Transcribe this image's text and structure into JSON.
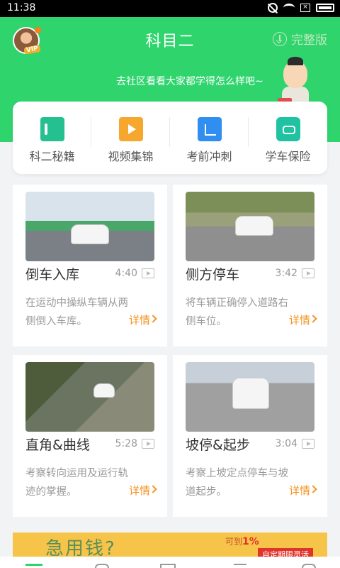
{
  "status_bar": {
    "time": "11:38"
  },
  "header": {
    "title": "科目二",
    "full_version": "完整版",
    "vip": "VIP",
    "community_link": "去社区看看大家都学得怎么样吧~"
  },
  "quick_links": [
    {
      "label": "科二秘籍",
      "icon": "book-icon"
    },
    {
      "label": "视频集锦",
      "icon": "video-icon"
    },
    {
      "label": "考前冲刺",
      "icon": "exam-icon"
    },
    {
      "label": "学车保险",
      "icon": "insurance-icon"
    }
  ],
  "videos": [
    {
      "title": "倒车入库",
      "duration": "4:40",
      "desc": "在运动中操纵车辆从两侧倒入车库。",
      "more": "详情"
    },
    {
      "title": "侧方停车",
      "duration": "3:42",
      "desc": "将车辆正确停入道路右侧车位。",
      "more": "详情"
    },
    {
      "title": "直角&曲线",
      "duration": "5:28",
      "desc": "考察转向运用及运行轨迹的掌握。",
      "more": "详情"
    },
    {
      "title": "坡停&起步",
      "duration": "3:04",
      "desc": "考察上坡定点停车与坡道起步。",
      "more": "详情"
    }
  ],
  "banner": {
    "text": "急用钱?",
    "rate_label": "可到",
    "rate": "1%",
    "tag": "自定期限灵活"
  },
  "colors": {
    "primary": "#2fd46d",
    "accent": "#f39323"
  }
}
